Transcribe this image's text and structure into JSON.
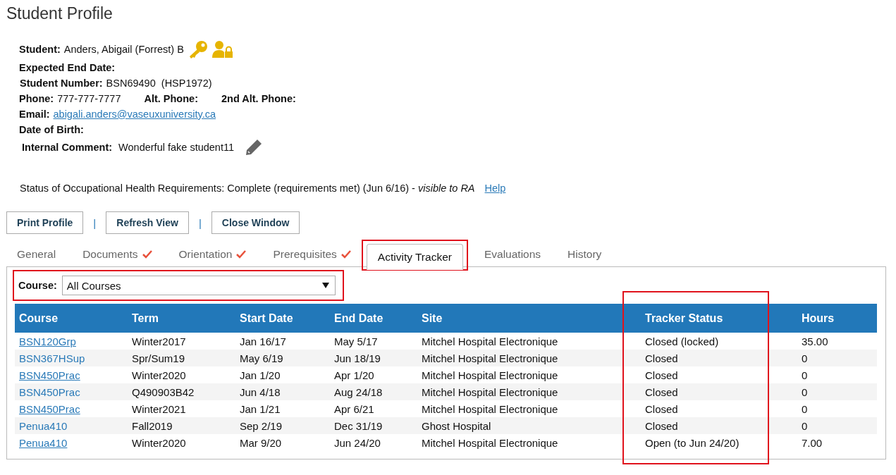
{
  "page_title": "Student Profile",
  "student": {
    "label": "Student:",
    "value": "Anders, Abigail (Forrest) B"
  },
  "fields": [
    {
      "label": "Expected End Date:"
    },
    {
      "label": "Student Number:",
      "value": "BSN69490  (HSP1972)"
    }
  ],
  "phones": [
    {
      "label": "Phone:",
      "value": "777-777-7777"
    },
    {
      "label": "Alt. Phone:"
    },
    {
      "label": "2nd Alt. Phone:"
    }
  ],
  "email": {
    "label": "Email:",
    "value": "abigali.anders@vaseuxuniversity.ca"
  },
  "birth": {
    "label": "Date of Birth:"
  },
  "comment": {
    "label": "Internal Comment:",
    "value": "Wonderful fake student11"
  },
  "health_status": {
    "text": "Status of Occupational Health Requirements: Complete (requirements met) (Jun 6/16) - *visible to RA*",
    "link": "Help"
  },
  "actions": [
    "Print Profile",
    "|",
    "Refresh View",
    "|",
    "Close Window"
  ],
  "tabs": [
    {
      "label": "General",
      "selected": false,
      "checked": false,
      "highlighted": false
    },
    {
      "label": "Documents",
      "selected": false,
      "checked": true,
      "highlighted": false
    },
    {
      "label": "Orientation",
      "selected": false,
      "checked": true,
      "highlighted": false
    },
    {
      "label": "Prerequisites",
      "selected": false,
      "checked": true,
      "highlighted": false
    },
    {
      "label": "Activity Tracker",
      "selected": true,
      "checked": false,
      "highlighted": true
    },
    {
      "label": "Evaluations",
      "selected": false,
      "checked": false,
      "highlighted": false
    },
    {
      "label": "History",
      "selected": false,
      "checked": false,
      "highlighted": false
    }
  ],
  "course_filter": {
    "label": "Course:",
    "value": "All Courses",
    "highlighted": true
  },
  "table": {
    "columns": [
      {
        "label": "Course",
        "highlighted": false
      },
      {
        "label": "Term",
        "highlighted": false
      },
      {
        "label": "Start Date",
        "highlighted": false
      },
      {
        "label": "End Date",
        "highlighted": false
      },
      {
        "label": "Site",
        "highlighted": false
      },
      {
        "label": "Tracker Status",
        "highlighted": true
      },
      {
        "label": "Hours",
        "highlighted": false
      }
    ],
    "rows": [
      {
        "course": "BSN120Grp",
        "underlined": true,
        "term": "Winter2017",
        "start": "Jan 16/17",
        "end": "May 5/17",
        "site": "Mitchel Hospital Electronique",
        "status": "Closed (locked)",
        "hours": "35.00"
      },
      {
        "course": "BSN367HSup",
        "underlined": false,
        "term": "Spr/Sum19",
        "start": "May 6/19",
        "end": "Jun 18/19",
        "site": "Mitchel Hospital Electronique",
        "status": "Closed",
        "hours": "0"
      },
      {
        "course": "BSN450Prac",
        "underlined": true,
        "term": "Winter2020",
        "start": "Jan 1/20",
        "end": "Apr 1/20",
        "site": "Mitchel Hospital Electronique",
        "status": "Closed",
        "hours": "0"
      },
      {
        "course": "BSN450Prac",
        "underlined": false,
        "term": "Q490903B42",
        "start": "Jun 4/18",
        "end": "Aug 24/18",
        "site": "Mitchel Hospital Electronique",
        "status": "Closed",
        "hours": "0"
      },
      {
        "course": "BSN450Prac",
        "underlined": true,
        "term": "Winter2021",
        "start": "Jan 1/21",
        "end": "Apr 6/21",
        "site": "Mitchel Hospital Electronique",
        "status": "Closed",
        "hours": "0"
      },
      {
        "course": "Penua410",
        "underlined": false,
        "term": "Fall2019",
        "start": "Sep 2/19",
        "end": "Dec 31/19",
        "site": "Ghost Hospital",
        "status": "Closed",
        "hours": "0"
      },
      {
        "course": "Penua410",
        "underlined": true,
        "term": "Winter2020",
        "start": "Mar 9/20",
        "end": "Jun 24/20",
        "site": "Mitchel Hospital Electronique",
        "status": "Open (to Jun 24/20)",
        "hours": "7.00"
      }
    ]
  }
}
